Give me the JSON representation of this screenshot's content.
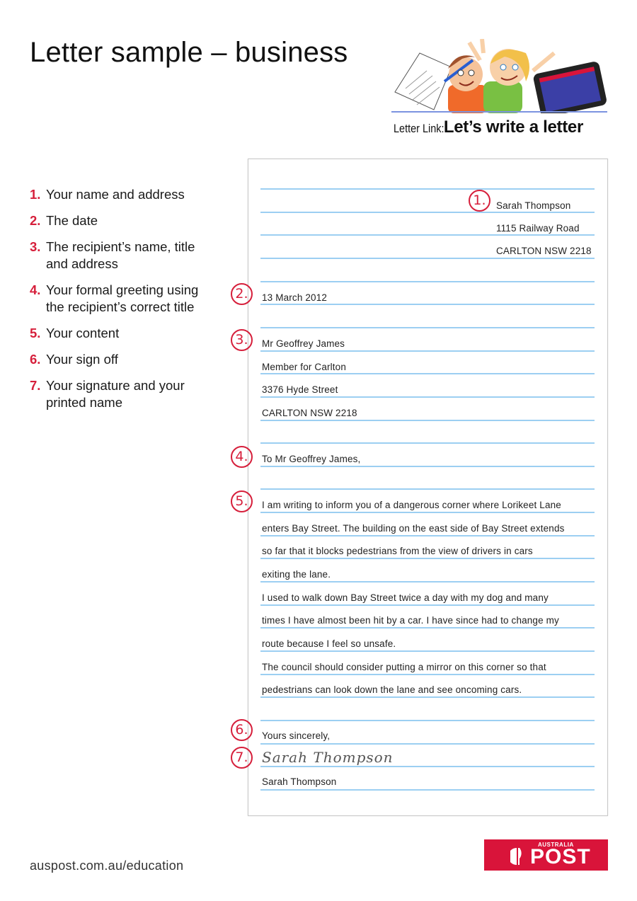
{
  "header": {
    "title": "Letter sample – business",
    "letter_link_prefix": "Letter Link:",
    "letter_link_title": "Let’s write a letter",
    "hero_image": "children-writing-letter-illustration"
  },
  "steps": [
    {
      "num": "1.",
      "text": "Your name and address"
    },
    {
      "num": "2.",
      "text": "The date"
    },
    {
      "num": "3.",
      "text": "The recipient’s name, title and address"
    },
    {
      "num": "4.",
      "text": "Your formal greeting using the recipient’s correct title"
    },
    {
      "num": "5.",
      "text": "Your content"
    },
    {
      "num": "6.",
      "text": "Your sign off"
    },
    {
      "num": "7.",
      "text": "Your signature and your printed name"
    }
  ],
  "letter": {
    "sender": {
      "name": "Sarah Thompson",
      "street": "1115 Railway Road",
      "city": "CARLTON NSW 2218"
    },
    "date": "13 March 2012",
    "recipient": {
      "name": "Mr Geoffrey James",
      "title": "Member for Carlton",
      "street": "3376 Hyde Street",
      "city": "CARLTON NSW 2218"
    },
    "greeting": "To Mr Geoffrey James,",
    "body_lines": [
      "I am writing to inform you of a dangerous corner where Lorikeet Lane",
      "enters Bay Street. The building on the east side of Bay Street extends",
      "so far that it blocks pedestrians from the view of drivers in cars",
      "exiting the lane.",
      "I used to walk down Bay Street twice a day with my dog and many",
      "times I have almost been hit by a car. I have since had to change my",
      "route because I feel so unsafe.",
      "The council should consider putting a mirror on this corner so that",
      "pedestrians can look down the lane and see oncoming cars."
    ],
    "sign_off": "Yours sincerely,",
    "signature": "Sarah Thompson",
    "printed_name": "Sarah Thompson"
  },
  "badges": [
    "1.",
    "2.",
    "3.",
    "4.",
    "5.",
    "6.",
    "7."
  ],
  "footer": {
    "url": "auspost.com.au/education",
    "logo_small": "AUSTRALIA",
    "logo_large": "POST"
  },
  "colors": {
    "accent_red": "#d61f3b",
    "rule_blue": "#9ccff2",
    "logo_red": "#d9143a"
  }
}
